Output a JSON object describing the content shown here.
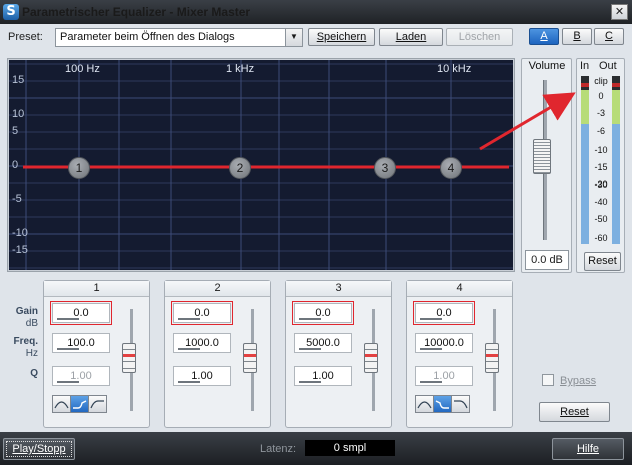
{
  "window": {
    "title": "Parametrischer Equalizer - Mixer Master",
    "app_icon": "S",
    "close_glyph": "✕"
  },
  "preset": {
    "label": "Preset:",
    "selected": "Parameter beim Öffnen des Dialogs",
    "save_label": "Speichern",
    "load_label": "Laden",
    "delete_label": "Löschen"
  },
  "abc_tabs": [
    {
      "label": "A",
      "active": true
    },
    {
      "label": "B",
      "active": false
    },
    {
      "label": "C",
      "active": false
    }
  ],
  "graph": {
    "y_labels": [
      "15",
      "10",
      "5",
      "0",
      "-5",
      "-10",
      "-15"
    ],
    "freq_labels": [
      "100 Hz",
      "1 kHz",
      "10 kHz"
    ],
    "curve_color": "#e0262e",
    "band_nodes": [
      "1",
      "2",
      "3",
      "4"
    ]
  },
  "volume": {
    "label": "Volume",
    "value": "0.0 dB"
  },
  "meter": {
    "in_label": "In",
    "out_label": "Out",
    "scale": [
      "clip",
      "0",
      "-3",
      "-6",
      "-10",
      "-15",
      "-20",
      "-30",
      "-40",
      "-50",
      "-60"
    ],
    "reset_label": "Reset"
  },
  "row_labels": {
    "gain": "Gain",
    "gain_unit": "dB",
    "freq": "Freq.",
    "freq_unit": "Hz",
    "q": "Q"
  },
  "bands": [
    {
      "title": "1",
      "gain": "0.0",
      "freq": "100.0",
      "q": "1.00",
      "shape_selected": "low-shelf"
    },
    {
      "title": "2",
      "gain": "0.0",
      "freq": "1000.0",
      "q": "1.00",
      "shape_selected": "peak"
    },
    {
      "title": "3",
      "gain": "0.0",
      "freq": "5000.0",
      "q": "1.00",
      "shape_selected": "peak"
    },
    {
      "title": "4",
      "gain": "0.0",
      "freq": "10000.0",
      "q": "1.00",
      "shape_selected": "high-shelf"
    }
  ],
  "bypass": {
    "label": "Bypass",
    "checked": false
  },
  "reset_label": "Reset",
  "footer": {
    "play_label": "Play/Stopp",
    "latency_label": "Latenz:",
    "latency_value": "0 smpl",
    "help_label": "Hilfe"
  },
  "annotation_color": "#e0262e"
}
